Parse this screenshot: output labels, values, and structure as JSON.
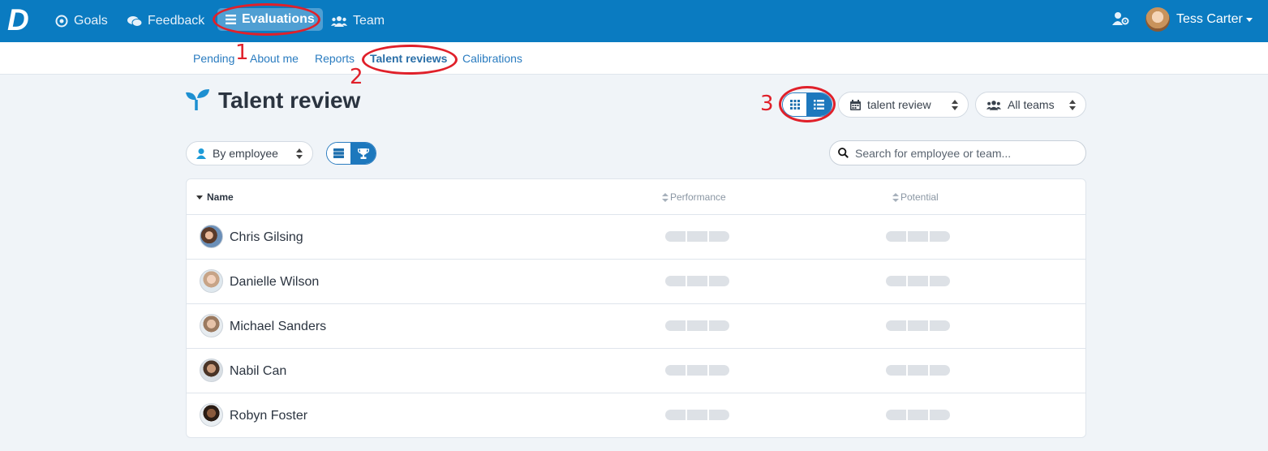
{
  "topnav": {
    "logo": "D",
    "items": [
      {
        "label": "Goals",
        "icon": "target-icon"
      },
      {
        "label": "Feedback",
        "icon": "comments-icon"
      },
      {
        "label": "Evaluations",
        "icon": "list-icon"
      },
      {
        "label": "Team",
        "icon": "users-icon"
      }
    ],
    "user_name": "Tess Carter"
  },
  "subnav": {
    "items": [
      "Pending",
      "About me",
      "Reports",
      "Talent reviews",
      "Calibrations"
    ]
  },
  "annotations": [
    "1",
    "2",
    "3"
  ],
  "page": {
    "title": "Talent review",
    "review_select": "talent review",
    "teams_select": "All teams",
    "group_select": "By employee",
    "search_placeholder": "Search for employee or team..."
  },
  "table": {
    "headers": {
      "name": "Name",
      "performance": "Performance",
      "potential": "Potential"
    },
    "rows": [
      {
        "name": "Chris Gilsing"
      },
      {
        "name": "Danielle Wilson"
      },
      {
        "name": "Michael Sanders"
      },
      {
        "name": "Nabil Can"
      },
      {
        "name": "Robyn Foster"
      }
    ]
  },
  "colors": {
    "brand": "#0a7bc1",
    "annotation": "#e0202a",
    "placeholder_bar": "#dde1e6"
  }
}
